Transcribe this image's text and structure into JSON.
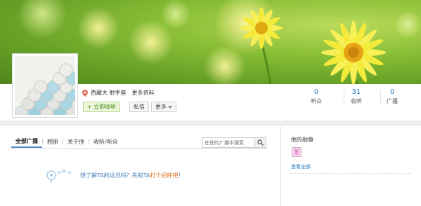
{
  "profile": {
    "location": "西藏大 射手座",
    "more_info": "更多资料"
  },
  "actions": {
    "follow_label": "+ 立即收听",
    "message_label": "私信",
    "more_label": "更多"
  },
  "stats": [
    {
      "value": "0",
      "label": "听众"
    },
    {
      "value": "31",
      "label": "收听"
    },
    {
      "value": "0",
      "label": "广播"
    }
  ],
  "tabs": [
    {
      "label": "全部广播",
      "active": true
    },
    {
      "label": "相册",
      "active": false
    },
    {
      "label": "关于他",
      "active": false
    },
    {
      "label": "收听/听众",
      "active": false
    }
  ],
  "search": {
    "placeholder": "在他的广播中搜索"
  },
  "empty_state": {
    "text": "想了解TA的近况吗？先和TA",
    "link": "打个招呼吧",
    "suffix": "！"
  },
  "sidebar": {
    "title": "他的勋章",
    "see_all": "查看全部"
  },
  "colors": {
    "accent_blue": "#2a7fc1",
    "link_orange": "#e0701a",
    "follow_green": "#3c8a12"
  }
}
